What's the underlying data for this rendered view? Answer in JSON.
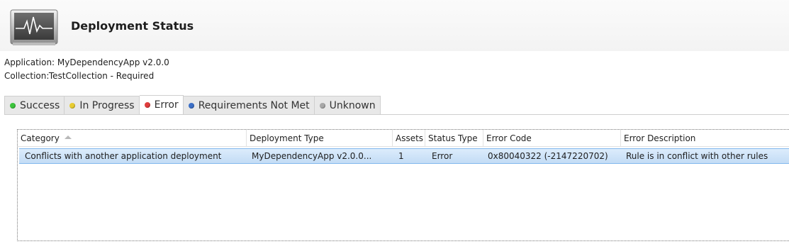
{
  "header": {
    "title": "Deployment Status",
    "icon": "activity-monitor-icon"
  },
  "info": {
    "application_label": "Application:",
    "application_value": "MyDependencyApp v2.0.0",
    "collection_label": "Collection:",
    "collection_value": "TestCollection - Required"
  },
  "tabs": [
    {
      "label": "Success",
      "color": "#3cc43c",
      "active": false
    },
    {
      "label": "In Progress",
      "color": "#e8cc30",
      "active": false
    },
    {
      "label": "Error",
      "color": "#e03c3c",
      "active": true
    },
    {
      "label": "Requirements Not Met",
      "color": "#3c70c8",
      "active": false
    },
    {
      "label": "Unknown",
      "color": "#a8a8a8",
      "active": false
    }
  ],
  "table": {
    "columns": [
      "Category",
      "Deployment Type",
      "Assets",
      "Status Type",
      "Error Code",
      "Error Description"
    ],
    "sorted_column": "Category",
    "sort_direction": "ascending",
    "rows": [
      {
        "category": "Conflicts with another application deployment",
        "deployment_type": "MyDependencyApp v2.0.0...",
        "assets": "1",
        "status_type": "Error",
        "error_code": "0x80040322 (-2147220702)",
        "error_description": "Rule is in conflict with other rules"
      }
    ]
  },
  "colors": {
    "selection": "#c9e0f7",
    "selection_border": "#84b9ee"
  }
}
